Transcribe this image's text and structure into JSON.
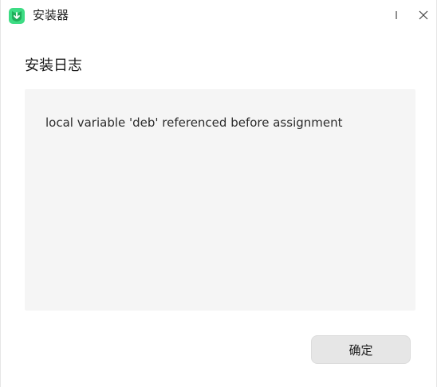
{
  "window": {
    "title": "安装器",
    "icon": "installer-app-icon",
    "controls": {
      "minimize_icon": "minimize-icon",
      "close_icon": "close-icon"
    }
  },
  "log": {
    "heading": "安装日志",
    "message": "local variable 'deb' referenced before assignment"
  },
  "actions": {
    "confirm_label": "确定"
  },
  "colors": {
    "app_icon_green": "#3ddc84",
    "app_icon_dark_green": "#1fae5a",
    "log_background": "#f5f5f5",
    "button_background": "#e6e6e6"
  }
}
